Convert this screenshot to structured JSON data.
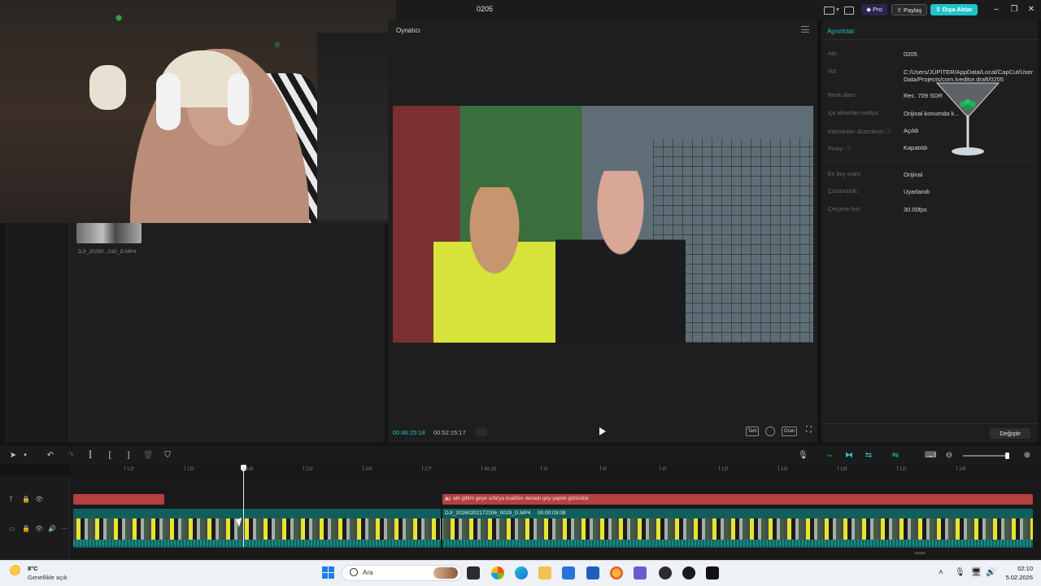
{
  "window": {
    "project_title": "0205",
    "pro_label": "Pro",
    "share_label": "Paylaş",
    "export_label": "Dışa Aktar",
    "accent": "#1fc4c9"
  },
  "media": {
    "clip_name": "DJI_20260...030_D.MP4"
  },
  "player": {
    "title": "Oynatıcı",
    "time_current": "00:46:25:18",
    "time_total": "00:52:15:17",
    "btn_full": "Tam",
    "btn_ratio": "Oran"
  },
  "details": {
    "title": "Ayrıntılar",
    "rows": [
      {
        "label": "Adı:",
        "value": "0205"
      },
      {
        "label": "Yol:",
        "value": "C:/Users/JÜPİTER/AppData/Local/CapCut/User Data/Projects/com.lveditor.draft/0205"
      },
      {
        "label": "Renk alanı:",
        "value": "Rec. 709 SDR"
      },
      {
        "label": "İçe aktarılan medya:",
        "value": "Orijinal konumda k..."
      },
      {
        "label": "Katmanları düzenleyin ⓘ",
        "value": "Açıldı"
      },
      {
        "label": "Proxy: ⓘ",
        "value": "Kapatıldı"
      },
      {
        "label": "En boy oranı:",
        "value": "Orijinal"
      },
      {
        "label": "Çözünürlük:",
        "value": "Uyarlandı"
      },
      {
        "label": "Çerçeve hızı:",
        "value": "30.00fps"
      }
    ],
    "modify_label": "Değiştir"
  },
  "timeline": {
    "ruler_ticks": [
      "12f",
      "15f",
      "18f",
      "21f",
      "24f",
      "27f",
      "46:26",
      "3f",
      "6f",
      "9f",
      "12f",
      "15f",
      "18f",
      "21f",
      "24f"
    ],
    "text_clip_label": "abi gittim geye urfa'ya kuaföre danadı gey yaptık götürdük",
    "text_clip_icon": "A⁝",
    "video_clip_label": "DJI_20260202172206_0029_D.MP4",
    "video_clip_duration": "00:00:03:08"
  },
  "taskbar": {
    "weather_temp": "8°C",
    "weather_text": "Genellikle açık",
    "search_placeholder": "Ara",
    "time": "02:10",
    "date": "5.02.2026"
  }
}
